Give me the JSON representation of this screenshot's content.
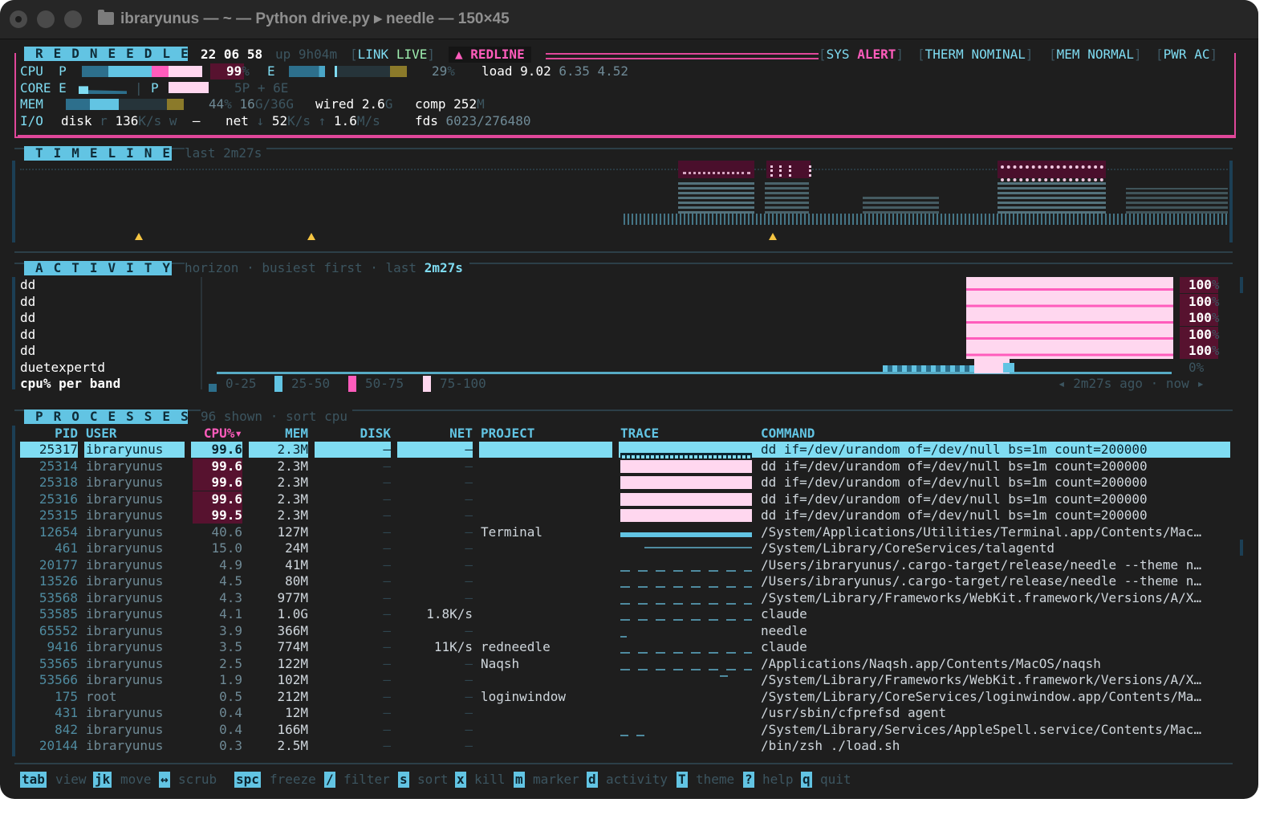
{
  "window": {
    "title": "ibraryunus — ~ — Python drive.py ▸ needle — 150×45"
  },
  "status": {
    "brand": "REDNEEDLE",
    "clock": {
      "h": "22",
      "m": "06",
      "s": "58"
    },
    "uptime_label": "up",
    "uptime": "9h04m",
    "link_label": "LINK",
    "link_value": "LIVE",
    "redline": "▲ REDLINE",
    "sys_label": "SYS",
    "sys_value": "ALERT",
    "therm_label": "THERM",
    "therm_value": "NOMINAL",
    "mem_label": "MEM",
    "mem_value": "NORMAL",
    "pwr_label": "PWR",
    "pwr_value": "AC",
    "cpu_label": "CPU",
    "p_label": "P",
    "cpu_p": "99",
    "pct": "%",
    "e_label": "E",
    "cpu_e": "29",
    "load_label": "load",
    "load1": "9.02",
    "load5": "6.35",
    "load15": "4.52",
    "core_label": "CORE",
    "core_e": "E",
    "core_p": "P",
    "core_split": "5P + 6E",
    "mem_row_label": "MEM",
    "mem_pct": "44",
    "mem_used": "16",
    "mem_total": "G/36G",
    "wired_label": "wired",
    "wired": "2.6",
    "wired_unit": "G",
    "comp_label": "comp",
    "comp": "252",
    "comp_unit": "M",
    "io_label": "I/O",
    "disk_label": "disk",
    "disk_r": "r",
    "disk_read": "136",
    "disk_unit": "K/s",
    "disk_w": "w",
    "disk_write": "–",
    "net_label": "net",
    "net_down_arrow": "↓",
    "net_down": "52",
    "net_down_unit": "K/s",
    "net_up_arrow": "↑",
    "net_up": "1.6",
    "net_up_unit": "M/s",
    "fds_label": "fds",
    "fds": "6023/276480"
  },
  "timeline": {
    "title": "TIMELINE",
    "sub": "last 2m27s"
  },
  "activity": {
    "title": "ACTIVITY",
    "sub1": "horizon",
    "sep": "·",
    "sub2": "busiest first",
    "sub3": "last",
    "span": "2m27s",
    "rows": [
      {
        "name": "dd",
        "pct": "100"
      },
      {
        "name": "dd",
        "pct": "100"
      },
      {
        "name": "dd",
        "pct": "100"
      },
      {
        "name": "dd",
        "pct": "100"
      },
      {
        "name": "dd",
        "pct": "100"
      },
      {
        "name": "duetexpertd",
        "pct": "0"
      }
    ],
    "pct_sign": "%",
    "legend_label": "cpu% per band",
    "bands": [
      "0-25",
      "25-50",
      "50-75",
      "75-100"
    ],
    "time_left": "◂ 2m27s ago",
    "time_sep": "·",
    "time_right": "now ▸"
  },
  "processes": {
    "title": "PROCESSES",
    "shown": "96 shown",
    "sep": "·",
    "sort": "sort cpu",
    "columns": {
      "pid": "PID",
      "user": "USER",
      "cpu": "CPU%▾",
      "mem": "MEM",
      "disk": "DISK",
      "net": "NET",
      "project": "PROJECT",
      "trace": "TRACE",
      "command": "COMMAND"
    },
    "rows": [
      {
        "pid": "25317",
        "user": "ibraryunus",
        "cpu": "99.6",
        "mem": "2.3M",
        "disk": "–",
        "net": "–",
        "project": "",
        "command": "dd if=/dev/urandom of=/dev/null bs=1m count=200000"
      },
      {
        "pid": "25314",
        "user": "ibraryunus",
        "cpu": "99.6",
        "mem": "2.3M",
        "disk": "–",
        "net": "–",
        "project": "",
        "command": "dd if=/dev/urandom of=/dev/null bs=1m count=200000"
      },
      {
        "pid": "25318",
        "user": "ibraryunus",
        "cpu": "99.6",
        "mem": "2.3M",
        "disk": "–",
        "net": "–",
        "project": "",
        "command": "dd if=/dev/urandom of=/dev/null bs=1m count=200000"
      },
      {
        "pid": "25316",
        "user": "ibraryunus",
        "cpu": "99.6",
        "mem": "2.3M",
        "disk": "–",
        "net": "–",
        "project": "",
        "command": "dd if=/dev/urandom of=/dev/null bs=1m count=200000"
      },
      {
        "pid": "25315",
        "user": "ibraryunus",
        "cpu": "99.5",
        "mem": "2.3M",
        "disk": "–",
        "net": "–",
        "project": "",
        "command": "dd if=/dev/urandom of=/dev/null bs=1m count=200000"
      },
      {
        "pid": "12654",
        "user": "ibraryunus",
        "cpu": "40.6",
        "mem": "127M",
        "disk": "–",
        "net": "–",
        "project": "Terminal",
        "command": "/System/Applications/Utilities/Terminal.app/Contents/Mac…"
      },
      {
        "pid": "461",
        "user": "ibraryunus",
        "cpu": "15.0",
        "mem": "24M",
        "disk": "–",
        "net": "–",
        "project": "",
        "command": "/System/Library/CoreServices/talagentd"
      },
      {
        "pid": "20177",
        "user": "ibraryunus",
        "cpu": "4.9",
        "mem": "41M",
        "disk": "–",
        "net": "–",
        "project": "",
        "command": "/Users/ibraryunus/.cargo-target/release/needle --theme n…"
      },
      {
        "pid": "13526",
        "user": "ibraryunus",
        "cpu": "4.5",
        "mem": "80M",
        "disk": "–",
        "net": "–",
        "project": "",
        "command": "/Users/ibraryunus/.cargo-target/release/needle --theme n…"
      },
      {
        "pid": "53568",
        "user": "ibraryunus",
        "cpu": "4.3",
        "mem": "977M",
        "disk": "–",
        "net": "–",
        "project": "",
        "command": "/System/Library/Frameworks/WebKit.framework/Versions/A/X…"
      },
      {
        "pid": "53585",
        "user": "ibraryunus",
        "cpu": "4.1",
        "mem": "1.0G",
        "disk": "–",
        "net": "1.8K/s",
        "project": "",
        "command": "claude"
      },
      {
        "pid": "65552",
        "user": "ibraryunus",
        "cpu": "3.9",
        "mem": "366M",
        "disk": "–",
        "net": "–",
        "project": "",
        "command": "needle"
      },
      {
        "pid": "9416",
        "user": "ibraryunus",
        "cpu": "3.5",
        "mem": "774M",
        "disk": "–",
        "net": "11K/s",
        "project": "redneedle",
        "command": "claude"
      },
      {
        "pid": "53565",
        "user": "ibraryunus",
        "cpu": "2.5",
        "mem": "122M",
        "disk": "–",
        "net": "–",
        "project": "Naqsh",
        "command": "/Applications/Naqsh.app/Contents/MacOS/naqsh"
      },
      {
        "pid": "53566",
        "user": "ibraryunus",
        "cpu": "1.9",
        "mem": "102M",
        "disk": "–",
        "net": "–",
        "project": "",
        "command": "/System/Library/Frameworks/WebKit.framework/Versions/A/X…"
      },
      {
        "pid": "175",
        "user": "root",
        "cpu": "0.5",
        "mem": "212M",
        "disk": "–",
        "net": "–",
        "project": "loginwindow",
        "command": "/System/Library/CoreServices/loginwindow.app/Contents/Ma…"
      },
      {
        "pid": "431",
        "user": "ibraryunus",
        "cpu": "0.4",
        "mem": "12M",
        "disk": "–",
        "net": "–",
        "project": "",
        "command": "/usr/sbin/cfprefsd agent"
      },
      {
        "pid": "842",
        "user": "ibraryunus",
        "cpu": "0.4",
        "mem": "166M",
        "disk": "–",
        "net": "–",
        "project": "",
        "command": "/System/Library/Services/AppleSpell.service/Contents/Mac…"
      },
      {
        "pid": "20144",
        "user": "ibraryunus",
        "cpu": "0.3",
        "mem": "2.5M",
        "disk": "–",
        "net": "–",
        "project": "",
        "command": "/bin/zsh ./load.sh"
      }
    ]
  },
  "footer": [
    {
      "key": "tab",
      "label": "view"
    },
    {
      "key": "jk",
      "label": "move"
    },
    {
      "key": "↔",
      "label": "scrub"
    },
    {
      "key": "spc",
      "label": "freeze"
    },
    {
      "key": "/",
      "label": "filter"
    },
    {
      "key": "s",
      "label": "sort"
    },
    {
      "key": "x",
      "label": "kill"
    },
    {
      "key": "m",
      "label": "marker"
    },
    {
      "key": "d",
      "label": "activity"
    },
    {
      "key": "T",
      "label": "theme"
    },
    {
      "key": "?",
      "label": "help"
    },
    {
      "key": "q",
      "label": "quit"
    }
  ],
  "colors": {
    "accent": "#7fdcf2",
    "alert": "#ff5cbc",
    "header_bg": "#62c4e3",
    "bg": "#1e1e1e"
  }
}
